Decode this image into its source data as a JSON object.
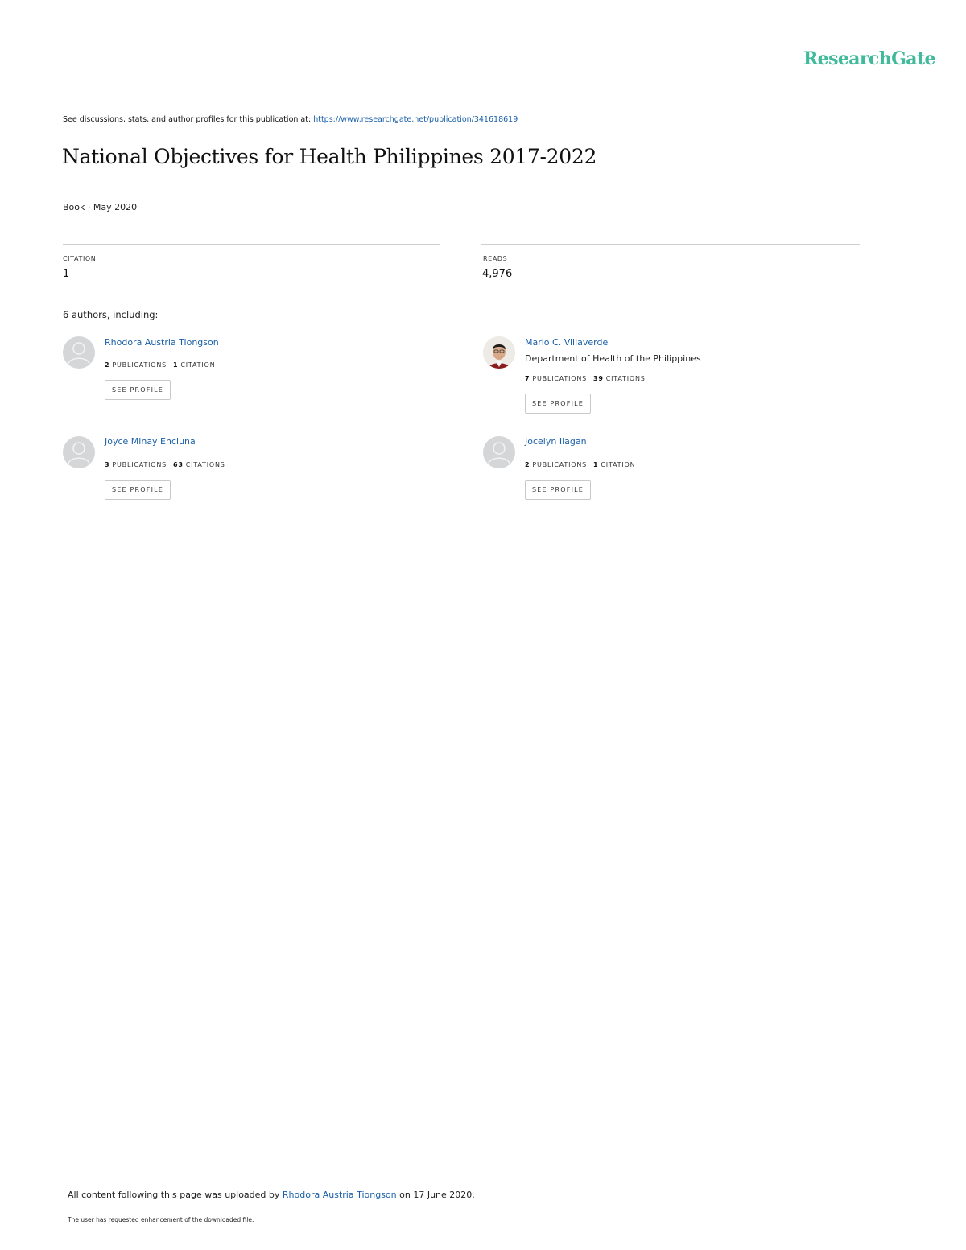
{
  "brand": {
    "logo_text": "ResearchGate",
    "logo_color": "#40ba9b",
    "link_color": "#1a5fa8"
  },
  "header": {
    "see_text": "See discussions, stats, and author profiles for this publication at: ",
    "publication_url": "https://www.researchgate.net/publication/341618619"
  },
  "publication": {
    "title": "National Objectives for Health Philippines 2017-2022",
    "meta": "Book · May 2020"
  },
  "stats": {
    "citation_label": "CITATION",
    "citation_value": "1",
    "reads_label": "READS",
    "reads_value": "4,976"
  },
  "authors_heading": "6 authors, including:",
  "authors": [
    {
      "name": "Rhodora Austria Tiongson",
      "affiliation": "",
      "publications_count": "2",
      "publications_label": "PUBLICATIONS",
      "citations_count": "1",
      "citations_label": "CITATION",
      "button_label": "SEE PROFILE"
    },
    {
      "name": "Mario C. Villaverde",
      "affiliation": "Department of Health of the Philippines",
      "publications_count": "7",
      "publications_label": "PUBLICATIONS",
      "citations_count": "39",
      "citations_label": "CITATIONS",
      "button_label": "SEE PROFILE"
    },
    {
      "name": "Joyce Minay Encluna",
      "affiliation": "",
      "publications_count": "3",
      "publications_label": "PUBLICATIONS",
      "citations_count": "63",
      "citations_label": "CITATIONS",
      "button_label": "SEE PROFILE"
    },
    {
      "name": "Jocelyn Ilagan",
      "affiliation": "",
      "publications_count": "2",
      "publications_label": "PUBLICATIONS",
      "citations_count": "1",
      "citations_label": "CITATION",
      "button_label": "SEE PROFILE"
    }
  ],
  "footer": {
    "prefix": "All content following this page was uploaded by ",
    "uploader": "Rhodora Austria Tiongson",
    "suffix": " on 17 June 2020.",
    "note": "The user has requested enhancement of the downloaded file."
  }
}
